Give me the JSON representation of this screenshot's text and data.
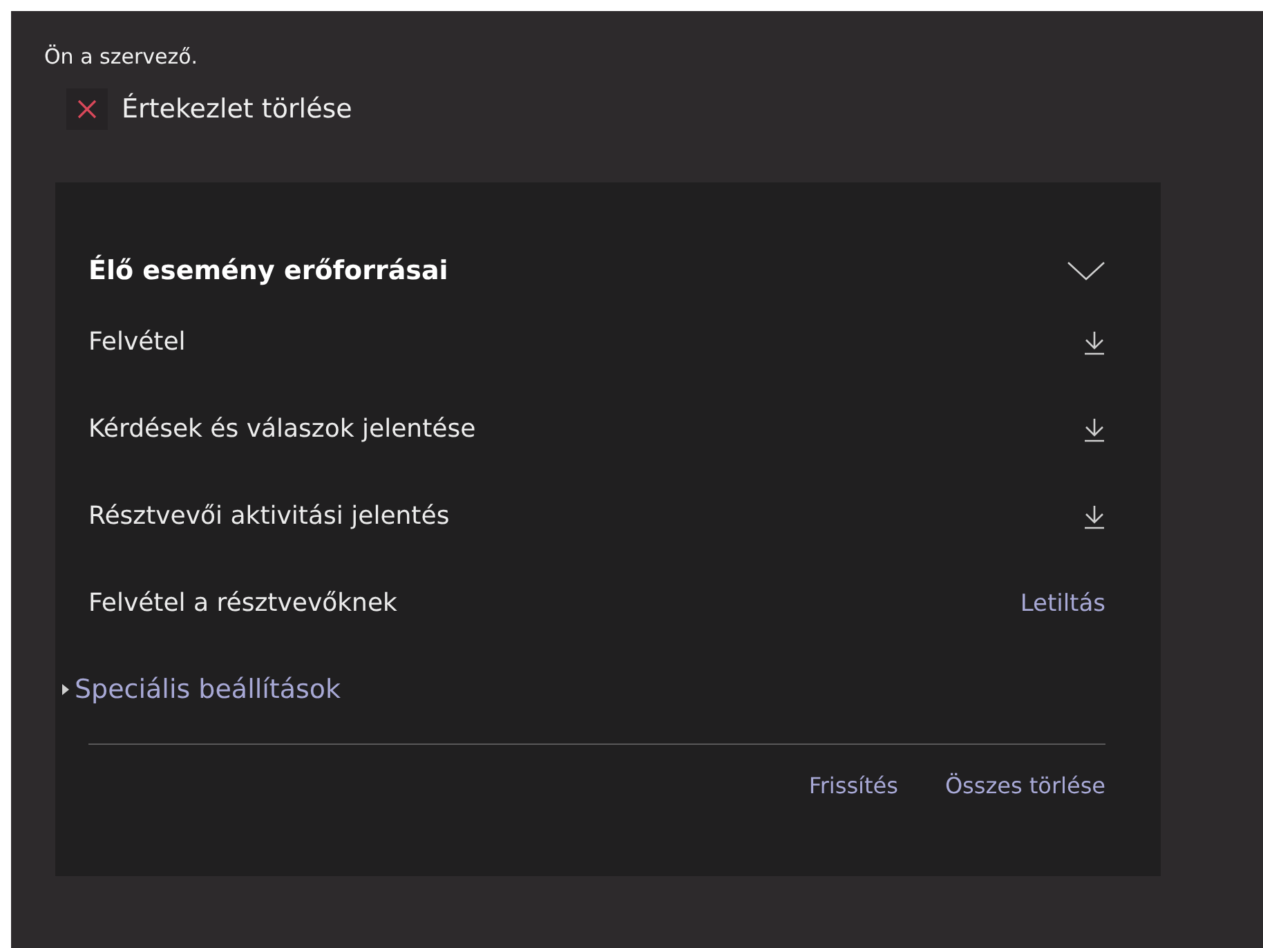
{
  "organizer_note": "Ön a szervező.",
  "delete_meeting": {
    "label": "Értekezlet törlése"
  },
  "section": {
    "title": "Élő esemény erőforrásai",
    "expanded": true,
    "items": [
      {
        "label": "Felvétel",
        "kind": "download"
      },
      {
        "label": "Kérdések és válaszok jelentése",
        "kind": "download"
      },
      {
        "label": "Résztvevői aktivitási jelentés",
        "kind": "download"
      },
      {
        "label": "Felvétel a résztvevőknek",
        "kind": "link",
        "action": "Letiltás"
      }
    ]
  },
  "advanced": {
    "label": "Speciális beállítások",
    "expanded": false
  },
  "footer_buttons": [
    "Frissítés",
    "Összes törlése"
  ]
}
